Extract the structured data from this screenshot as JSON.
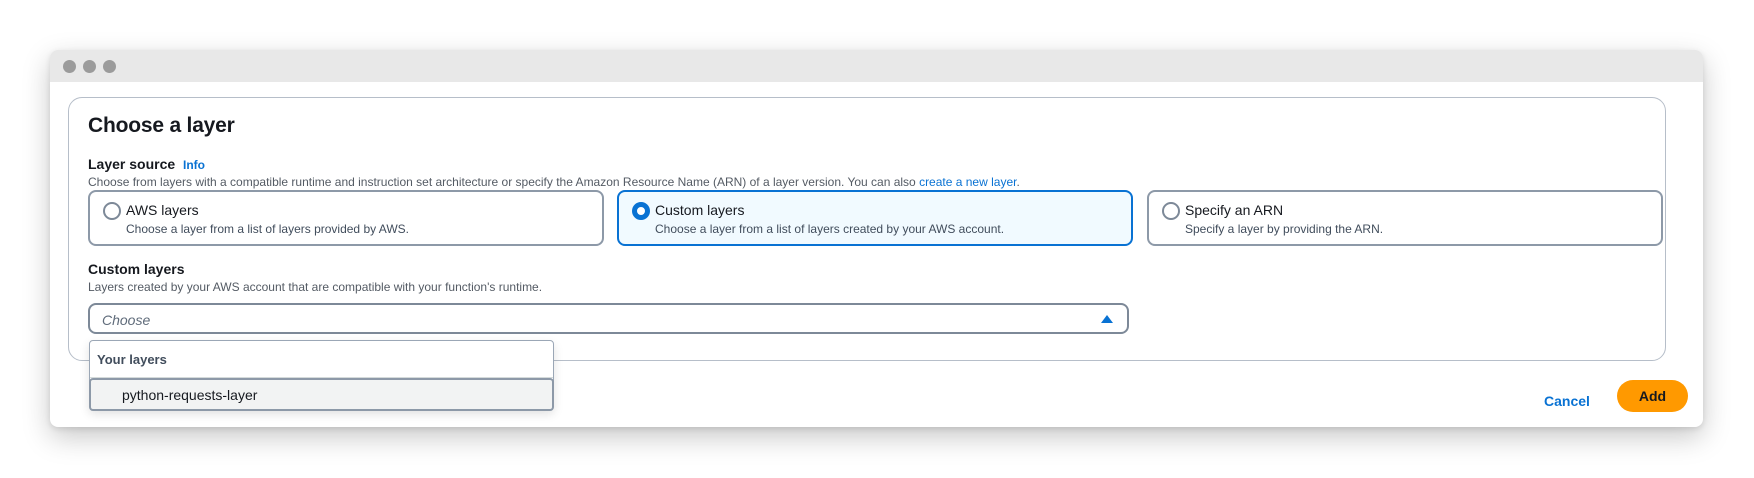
{
  "dialog": {
    "title": "Choose a layer",
    "layer_source": {
      "label": "Layer source",
      "info": "Info",
      "description": "Choose from layers with a compatible runtime and instruction set architecture or specify the Amazon Resource Name (ARN) of a layer version. You can also ",
      "description_link": "create a new layer",
      "description_end": ".",
      "options": [
        {
          "title": "AWS layers",
          "description": "Choose a layer from a list of layers provided by AWS.",
          "selected": false
        },
        {
          "title": "Custom layers",
          "description": "Choose a layer from a list of layers created by your AWS account.",
          "selected": true
        },
        {
          "title": "Specify an ARN",
          "description": "Specify a layer by providing the ARN.",
          "selected": false
        }
      ]
    },
    "custom_layers": {
      "label": "Custom layers",
      "description": "Layers created by your AWS account that are compatible with your function's runtime.",
      "select_placeholder": "Choose",
      "dropdown": {
        "group_label": "Your layers",
        "options": [
          "python-requests-layer"
        ]
      }
    },
    "footer": {
      "cancel_label": "Cancel",
      "add_label": "Add"
    }
  },
  "colors": {
    "accent": "#0972d3",
    "primary_button": "#ff9900",
    "selected_tile_bg": "#f1faff"
  },
  "icons": {
    "radio_unselected": "radio-empty",
    "radio_selected": "radio-filled",
    "dropdown_caret": "caret-up-icon"
  }
}
